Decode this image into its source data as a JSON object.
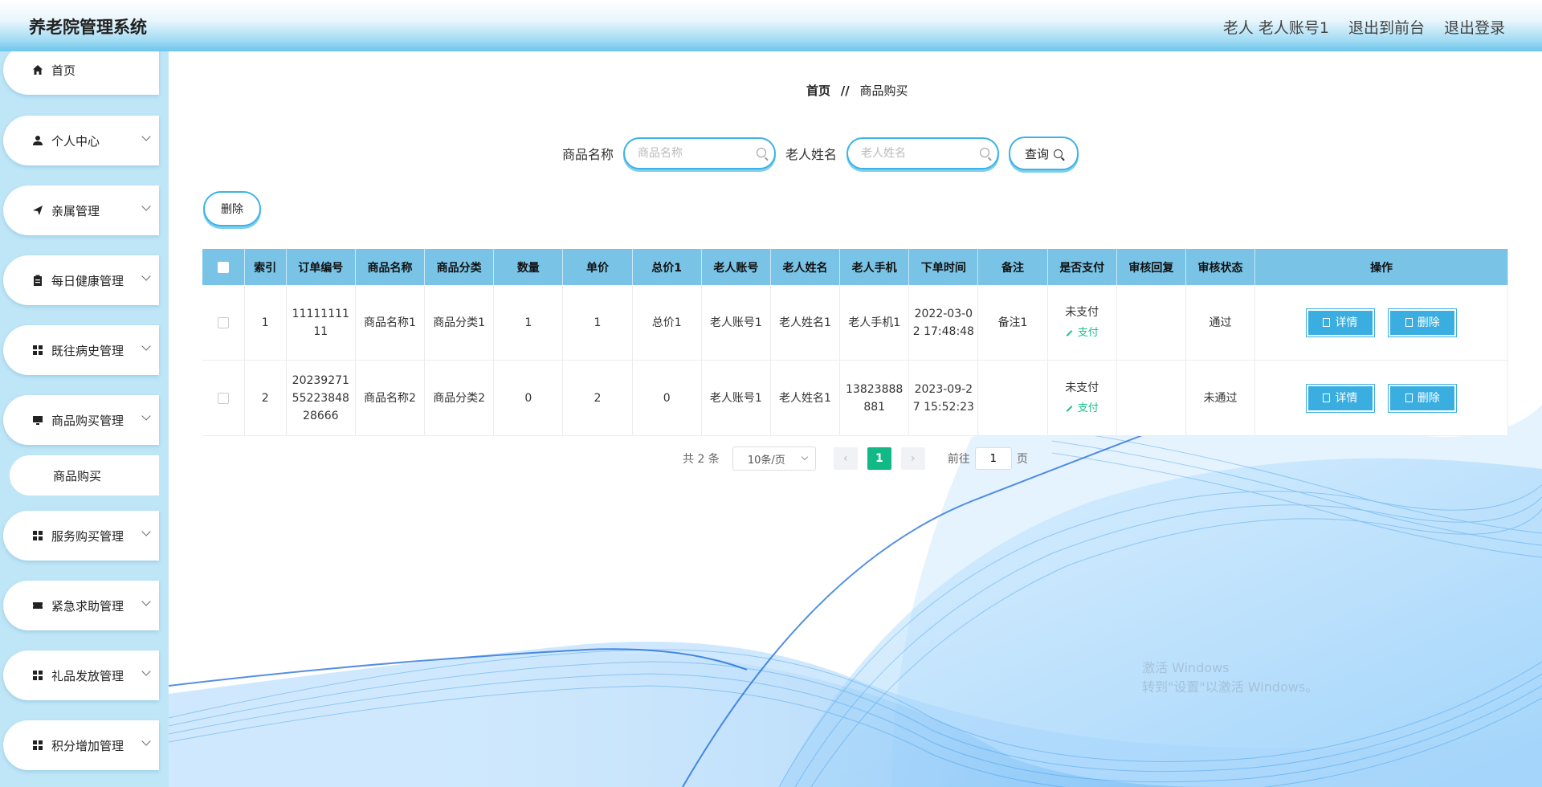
{
  "app": {
    "title": "养老院管理系统"
  },
  "topnav": {
    "user": "老人 老人账号1",
    "to_front": "退出到前台",
    "logout": "退出登录"
  },
  "sidebar": {
    "items": [
      {
        "label": "首页",
        "icon": "home-icon"
      },
      {
        "label": "个人中心",
        "icon": "user-icon"
      },
      {
        "label": "亲属管理",
        "icon": "send-icon"
      },
      {
        "label": "每日健康管理",
        "icon": "clipboard-icon"
      },
      {
        "label": "既往病史管理",
        "icon": "grid-icon"
      },
      {
        "label": "商品购买管理",
        "icon": "monitor-icon"
      },
      {
        "label": "服务购买管理",
        "icon": "grid-icon"
      },
      {
        "label": "紧急求助管理",
        "icon": "ticket-icon"
      },
      {
        "label": "礼品发放管理",
        "icon": "grid-icon"
      },
      {
        "label": "积分增加管理",
        "icon": "grid-icon"
      }
    ],
    "sub_item": "商品购买"
  },
  "breadcrumb": {
    "home": "首页",
    "sep": "//",
    "current": "商品购买"
  },
  "search": {
    "goods_label": "商品名称",
    "goods_placeholder": "商品名称",
    "elder_label": "老人姓名",
    "elder_placeholder": "老人姓名",
    "query": "查询"
  },
  "actions": {
    "delete": "删除"
  },
  "table": {
    "headers": [
      "索引",
      "订单编号",
      "商品名称",
      "商品分类",
      "数量",
      "单价",
      "总价1",
      "老人账号",
      "老人姓名",
      "老人手机",
      "下单时间",
      "备注",
      "是否支付",
      "审核回复",
      "审核状态",
      "操作"
    ],
    "rows": [
      {
        "index": "1",
        "order_no": "1111111111",
        "goods": "商品名称1",
        "category": "商品分类1",
        "qty": "1",
        "price": "1",
        "total": "总价1",
        "account": "老人账号1",
        "name": "老人姓名1",
        "phone": "老人手机1",
        "time": "2022-03-02 17:48:48",
        "remark": "备注1",
        "paid": "未支付",
        "pay": "支付",
        "reply": "",
        "status": "通过",
        "detail": "详情",
        "delete": "删除"
      },
      {
        "index": "2",
        "order_no": "202392715522384828666",
        "goods": "商品名称2",
        "category": "商品分类2",
        "qty": "0",
        "price": "2",
        "total": "0",
        "account": "老人账号1",
        "name": "老人姓名1",
        "phone": "13823888881",
        "time": "2023-09-27 15:52:23",
        "remark": "",
        "paid": "未支付",
        "pay": "支付",
        "reply": "",
        "status": "未通过",
        "detail": "详情",
        "delete": "删除"
      }
    ]
  },
  "pagination": {
    "total": "共 2 条",
    "page_size": "10条/页",
    "current": "1",
    "goto": "前往",
    "goto_value": "1",
    "page_unit": "页"
  },
  "watermark": {
    "line1": "激活 Windows",
    "line2": "转到\"设置\"以激活 Windows。"
  },
  "colors": {
    "accent": "#3aaee0",
    "header_blue": "#79c3e6",
    "active_page": "#12b886",
    "pay_green": "#1bbf8a"
  }
}
